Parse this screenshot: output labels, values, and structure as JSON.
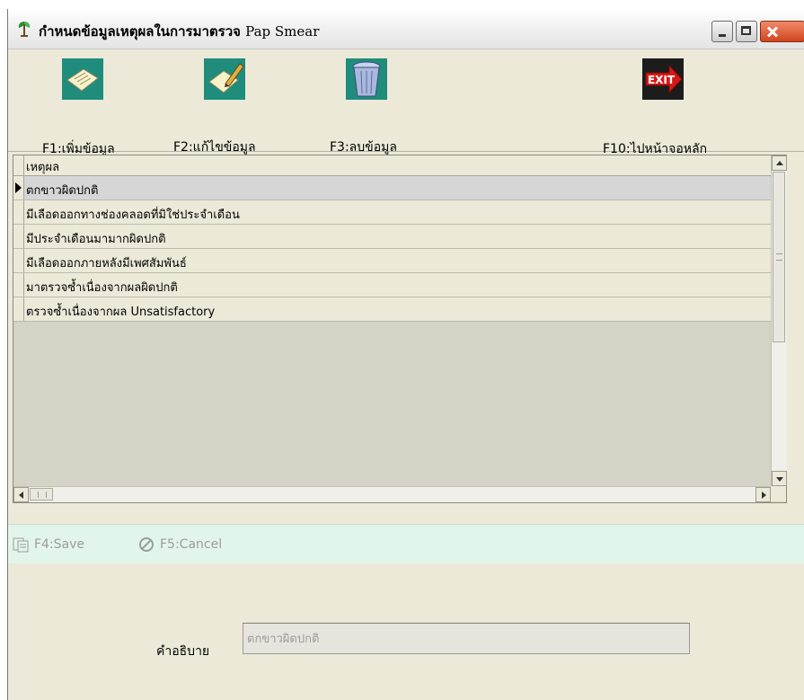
{
  "window": {
    "title_th": "กำหนดข้อมูลเหตุผลในการมาตรวจ",
    "title_en": "Pap Smear"
  },
  "toolbar": {
    "add_label": "F1:เพิ่มข้อมูล",
    "edit_label": "F2:แก้ไขข้อมูล",
    "delete_label": "F3:ลบข้อมูล",
    "exit_label": "F10:ไปหน้าจอหลัก",
    "exit_icon_text": "EXIT"
  },
  "grid": {
    "column_header": "เหตุผล",
    "rows": [
      "ตกขาวผิดปกติ",
      "มีเลือดออกทางช่องคลอดที่มิใช่ประจำเดือน",
      "มีประจำเดือนมามากผิดปกติ",
      "มีเลือดออกภายหลังมีเพศสัมพันธ์",
      "มาตรวจซ้ำเนื่องจากผลผิดปกติ",
      "ตรวจซ้ำเนื่องจากผล Unsatisfactory"
    ],
    "selected_row": 0
  },
  "actions": {
    "save_label": "F4:Save",
    "cancel_label": "F5:Cancel"
  },
  "form": {
    "description_label": "คำอธิบาย",
    "description_value": "ตกขาวผิดปกติ"
  }
}
